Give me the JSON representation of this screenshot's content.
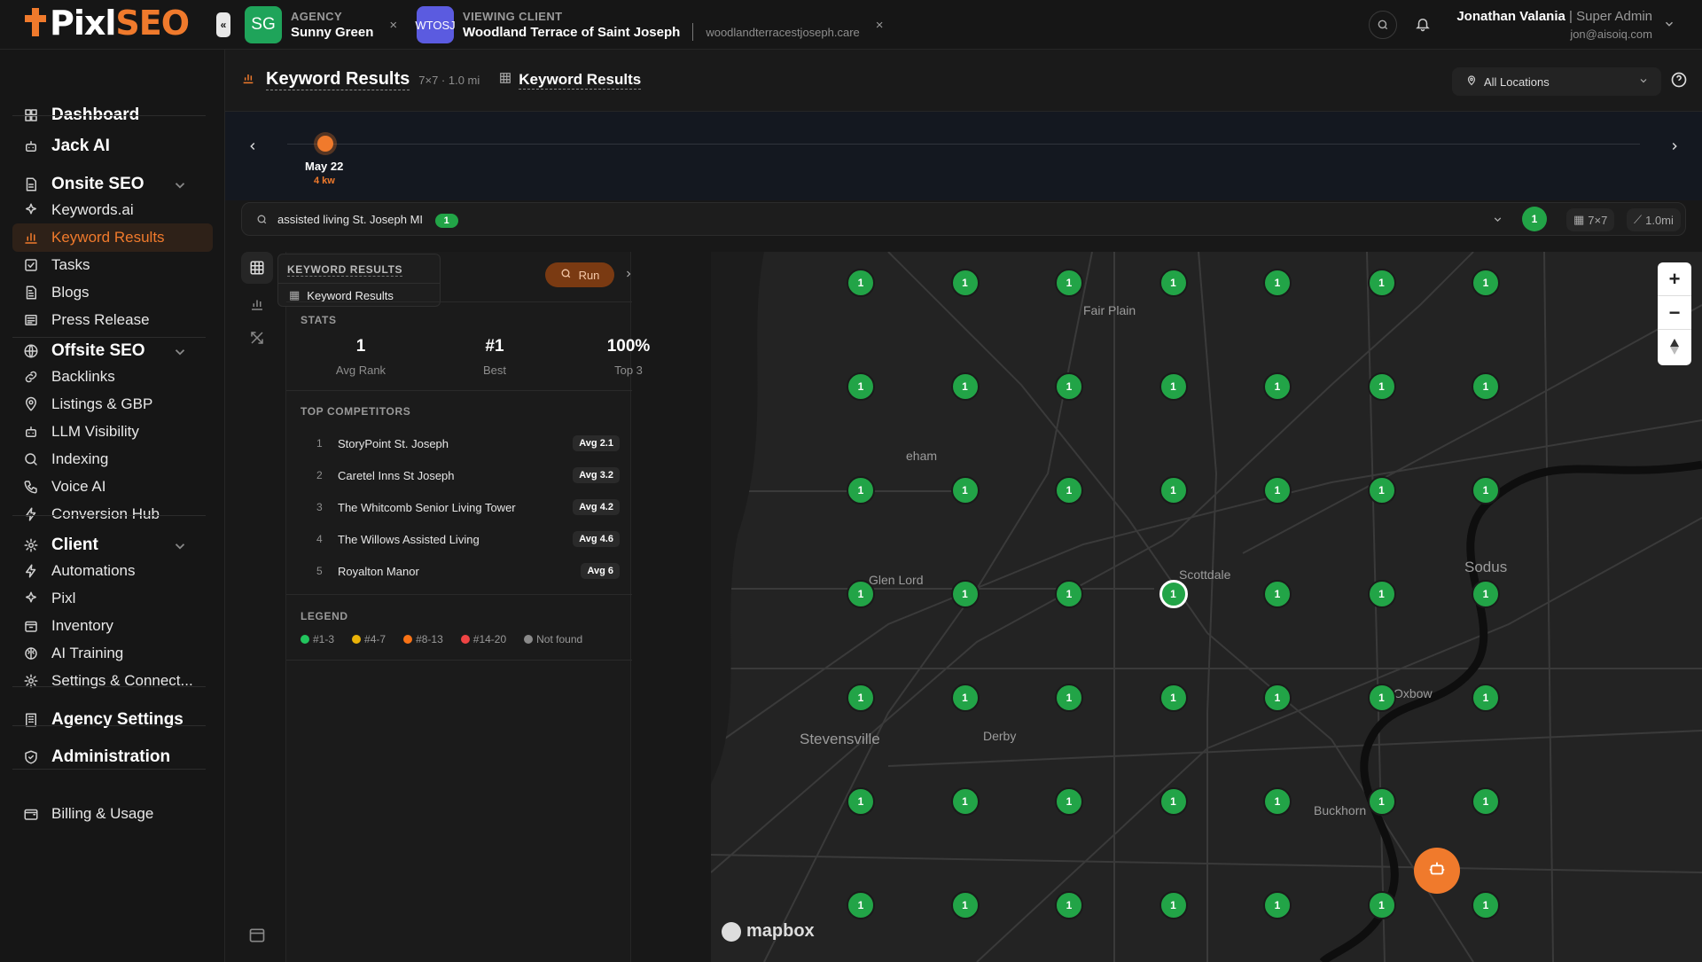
{
  "app": {
    "logo_main": "Pixl",
    "logo_accent": "SEO",
    "collapse_label": "«"
  },
  "agency": {
    "initials": "SG",
    "label": "AGENCY",
    "name": "Sunny Green",
    "color": "#1fa45a"
  },
  "client": {
    "initials": "WTOSJ",
    "label": "VIEWING CLIENT",
    "name": "Woodland Terrace of Saint Joseph",
    "domain": "woodlandterracestjoseph.care",
    "color": "#5b5be0"
  },
  "user": {
    "name": "Jonathan Valania",
    "role": "Super Admin",
    "email": "jon@aisoiq.com",
    "sep": "|"
  },
  "close_glyph": "×",
  "sidebar": {
    "items": [
      {
        "label": "Dashboard",
        "icon": "dashboard-icon",
        "head": true
      },
      {
        "label": "Jack AI",
        "icon": "robot-icon",
        "head": true
      },
      {
        "label": "Onsite SEO",
        "icon": "page-icon",
        "head": true,
        "group": true
      },
      {
        "label": "Keywords.ai",
        "icon": "sparkles-icon"
      },
      {
        "label": "Keyword Results",
        "icon": "bar-chart-icon",
        "active": true
      },
      {
        "label": "Tasks",
        "icon": "checkbox-icon"
      },
      {
        "label": "Blogs",
        "icon": "document-icon"
      },
      {
        "label": "Press Release",
        "icon": "newspaper-icon"
      },
      {
        "label": "Offsite SEO",
        "icon": "globe-icon",
        "head": true,
        "group": true
      },
      {
        "label": "Backlinks",
        "icon": "link-icon"
      },
      {
        "label": "Listings & GBP",
        "icon": "pin-icon"
      },
      {
        "label": "LLM Visibility",
        "icon": "robot-icon"
      },
      {
        "label": "Indexing",
        "icon": "search-icon"
      },
      {
        "label": "Voice AI",
        "icon": "phone-icon"
      },
      {
        "label": "Conversion Hub",
        "icon": "bolt-icon"
      },
      {
        "label": "Client",
        "icon": "gear-icon",
        "head": true,
        "group": true
      },
      {
        "label": "Automations",
        "icon": "bolt-icon"
      },
      {
        "label": "Pixl",
        "icon": "sparkles-icon"
      },
      {
        "label": "Inventory",
        "icon": "box-icon"
      },
      {
        "label": "AI Training",
        "icon": "brain-icon"
      },
      {
        "label": "Settings & Connect...",
        "icon": "gear-icon"
      },
      {
        "label": "Agency Settings",
        "icon": "building-icon",
        "head": true
      },
      {
        "label": "Administration",
        "icon": "shield-icon",
        "head": true
      },
      {
        "label": "Billing & Usage",
        "icon": "wallet-icon"
      }
    ]
  },
  "header": {
    "title": "Keyword Results",
    "meta": "7×7 · 1.0 mi",
    "crumb": "Keyword Results",
    "location": "All Locations"
  },
  "timeline": {
    "date": "May 22",
    "kw": "4 kw"
  },
  "keyword_bar": {
    "keyword": "assisted living St. Joseph MI",
    "rank": "1",
    "grid": "7×7",
    "radius": "1.0mi"
  },
  "panel": {
    "tab_title": "KEYWORD RESULTS",
    "tab_item": "Keyword Results",
    "run_label": "Run",
    "stats_title": "STATS",
    "stats": [
      {
        "value": "1",
        "label": "Avg Rank"
      },
      {
        "value": "#1",
        "label": "Best"
      },
      {
        "value": "100%",
        "label": "Top 3"
      }
    ],
    "competitors_title": "TOP COMPETITORS",
    "competitors": [
      {
        "rank": "1",
        "name": "StoryPoint St. Joseph",
        "avg": "Avg 2.1"
      },
      {
        "rank": "2",
        "name": "Caretel Inns St Joseph",
        "avg": "Avg 3.2"
      },
      {
        "rank": "3",
        "name": "The Whitcomb Senior Living Tower",
        "avg": "Avg 4.2"
      },
      {
        "rank": "4",
        "name": "The Willows Assisted Living",
        "avg": "Avg 4.6"
      },
      {
        "rank": "5",
        "name": "Royalton Manor",
        "avg": "Avg 6"
      }
    ],
    "legend_title": "LEGEND",
    "legend": [
      {
        "label": "#1-3",
        "color": "#22c55e"
      },
      {
        "label": "#4-7",
        "color": "#eab308"
      },
      {
        "label": "#8-13",
        "color": "#f97316"
      },
      {
        "label": "#14-20",
        "color": "#ef4444"
      },
      {
        "label": "Not found",
        "color": "#8a8a8a"
      }
    ]
  },
  "map": {
    "grid_value": "1",
    "places": [
      {
        "name": "Fair Plain"
      },
      {
        "name": "eham"
      },
      {
        "name": "Glen Lord"
      },
      {
        "name": "Scottdale"
      },
      {
        "name": "Sodus"
      },
      {
        "name": "Oxbow"
      },
      {
        "name": "Stevensville"
      },
      {
        "name": "Derby"
      },
      {
        "name": "Buckhorn"
      }
    ],
    "zoom_in": "+",
    "zoom_out": "−",
    "attribution": "mapbox",
    "colors": {
      "pin": "#22a447",
      "accent": "#f07a2c"
    }
  }
}
